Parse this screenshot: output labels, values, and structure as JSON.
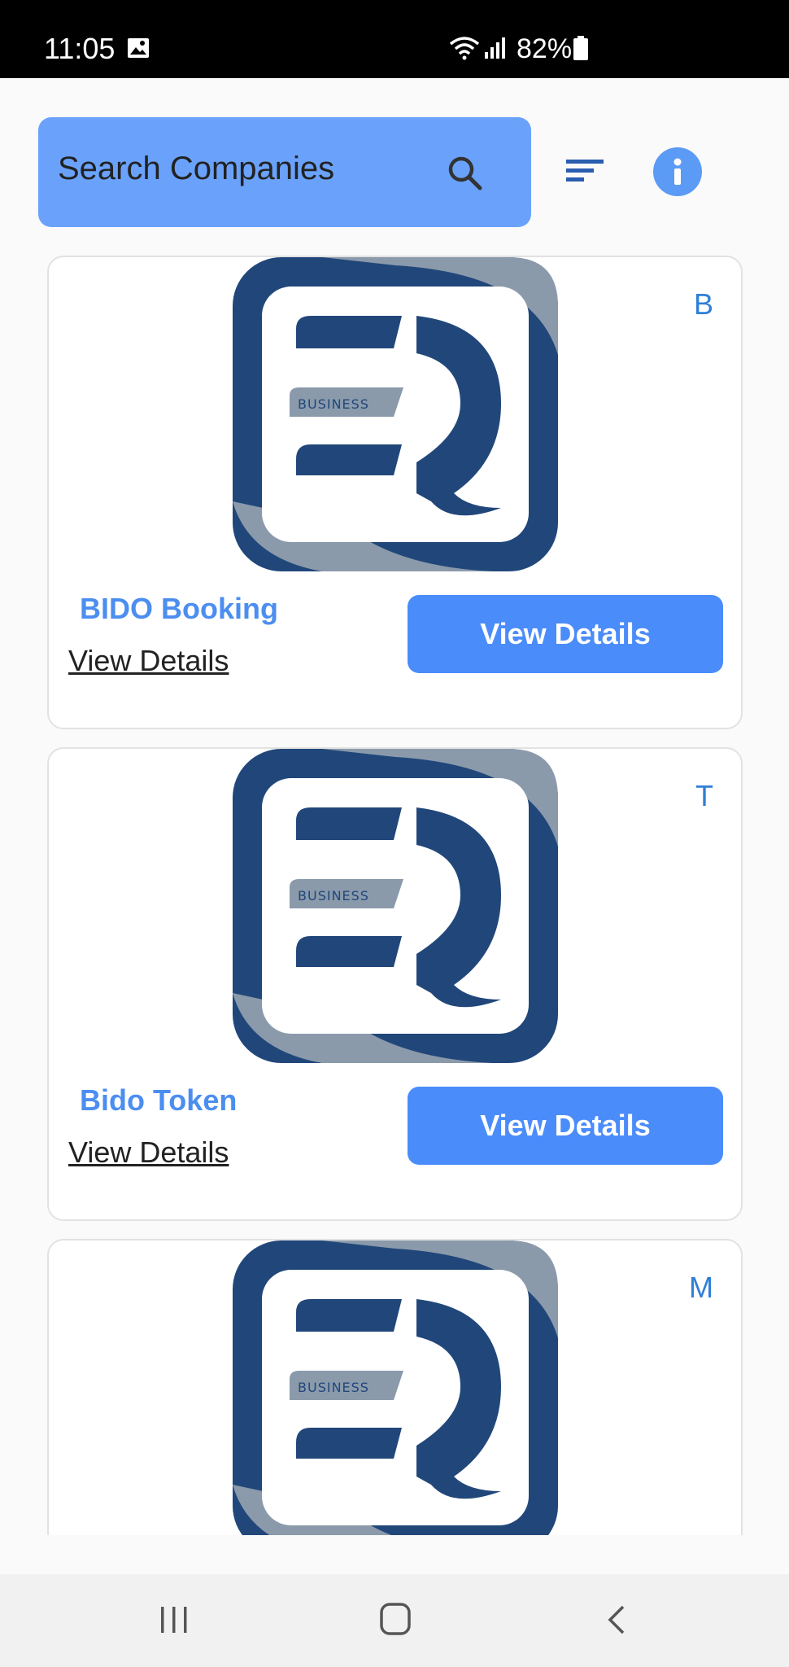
{
  "status_bar": {
    "time": "11:05",
    "battery": "82%",
    "icons": [
      "image-icon",
      "wifi-icon",
      "signal-icon",
      "battery-icon"
    ]
  },
  "search": {
    "placeholder": "Search Companies",
    "icon": "search-icon"
  },
  "toolbar": {
    "filter_icon": "filter-icon",
    "info_icon": "info-icon"
  },
  "companies": [
    {
      "letter": "B",
      "name": "BIDO Booking",
      "link": "View Details",
      "button": "View Details",
      "logo_text": "BUSINESS"
    },
    {
      "letter": "T",
      "name": "Bido Token",
      "link": "View Details",
      "button": "View Details",
      "logo_text": "BUSINESS"
    },
    {
      "letter": "M",
      "name": "",
      "link": "",
      "button": "",
      "logo_text": "BUSINESS"
    }
  ],
  "colors": {
    "search_bg": "#6aa2fb",
    "button_bg": "#4a8cfa",
    "title": "#4c8ef0",
    "logo_navy": "#21477a",
    "logo_gray": "#8a9aab"
  },
  "nav_bar": {
    "icons": [
      "recent-apps-icon",
      "home-icon",
      "back-icon"
    ]
  }
}
